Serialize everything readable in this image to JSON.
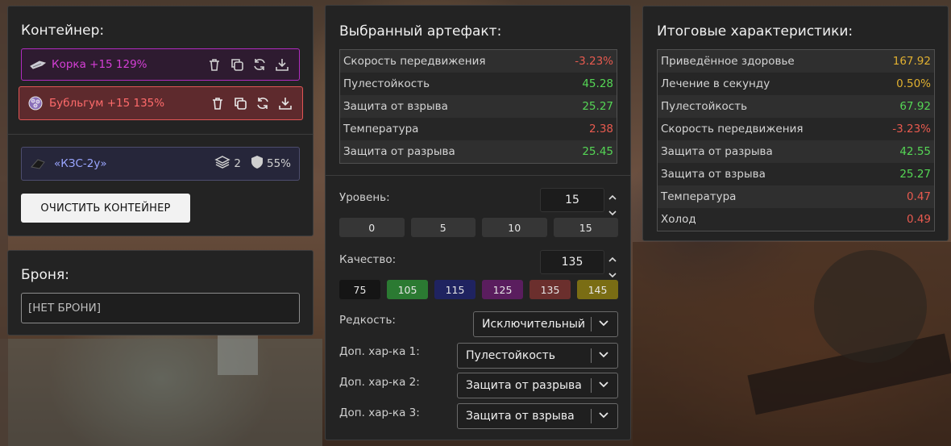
{
  "container": {
    "title": "Контейнер:",
    "artifacts": [
      {
        "label": "Корка +15 129%",
        "color": "#d53fd6"
      },
      {
        "label": "Бубльгум +15 135%",
        "color": "#ff6b6b"
      }
    ],
    "kzs": {
      "label": "«КЗС-2у»",
      "slots": "2",
      "protection": "55%"
    },
    "clear_button": "ОЧИСТИТЬ КОНТЕЙНЕР"
  },
  "armor": {
    "title": "Броня:",
    "value": "[НЕТ БРОНИ]"
  },
  "selected": {
    "title": "Выбранный артефакт:",
    "stats": [
      {
        "name": "Скорость передвижения",
        "value": "-3.23%",
        "tone": "neg"
      },
      {
        "name": "Пулестойкость",
        "value": "45.28",
        "tone": "pos"
      },
      {
        "name": "Защита от взрыва",
        "value": "25.27",
        "tone": "pos"
      },
      {
        "name": "Температура",
        "value": "2.38",
        "tone": "neg"
      },
      {
        "name": "Защита от разрыва",
        "value": "25.45",
        "tone": "pos"
      }
    ],
    "level": {
      "label": "Уровень:",
      "value": "15",
      "presets": [
        "0",
        "5",
        "10",
        "15"
      ]
    },
    "quality": {
      "label": "Качество:",
      "value": "135",
      "presets": [
        "75",
        "105",
        "115",
        "125",
        "135",
        "145"
      ]
    },
    "rarity": {
      "label": "Редкость:",
      "value": "Исключительный"
    },
    "extra1": {
      "label": "Доп. хар-ка 1:",
      "value": "Пулестойкость"
    },
    "extra2": {
      "label": "Доп. хар-ка 2:",
      "value": "Защита от разрыва"
    },
    "extra3": {
      "label": "Доп. хар-ка 3:",
      "value": "Защита от взрыва"
    }
  },
  "totals": {
    "title": "Итоговые характеристики:",
    "stats": [
      {
        "name": "Приведённое здоровье",
        "value": "167.92",
        "tone": "gold"
      },
      {
        "name": "Лечение в секунду",
        "value": "0.50%",
        "tone": "gold"
      },
      {
        "name": "Пулестойкость",
        "value": "67.92",
        "tone": "pos"
      },
      {
        "name": "Скорость передвижения",
        "value": "-3.23%",
        "tone": "neg"
      },
      {
        "name": "Защита от разрыва",
        "value": "42.55",
        "tone": "pos"
      },
      {
        "name": "Защита от взрыва",
        "value": "25.27",
        "tone": "pos"
      },
      {
        "name": "Температура",
        "value": "0.47",
        "tone": "neg"
      },
      {
        "name": "Холод",
        "value": "0.49",
        "tone": "neg"
      }
    ]
  },
  "colors": {
    "positive": "#55d655",
    "negative": "#e85a4f",
    "gold": "#e0b030"
  }
}
